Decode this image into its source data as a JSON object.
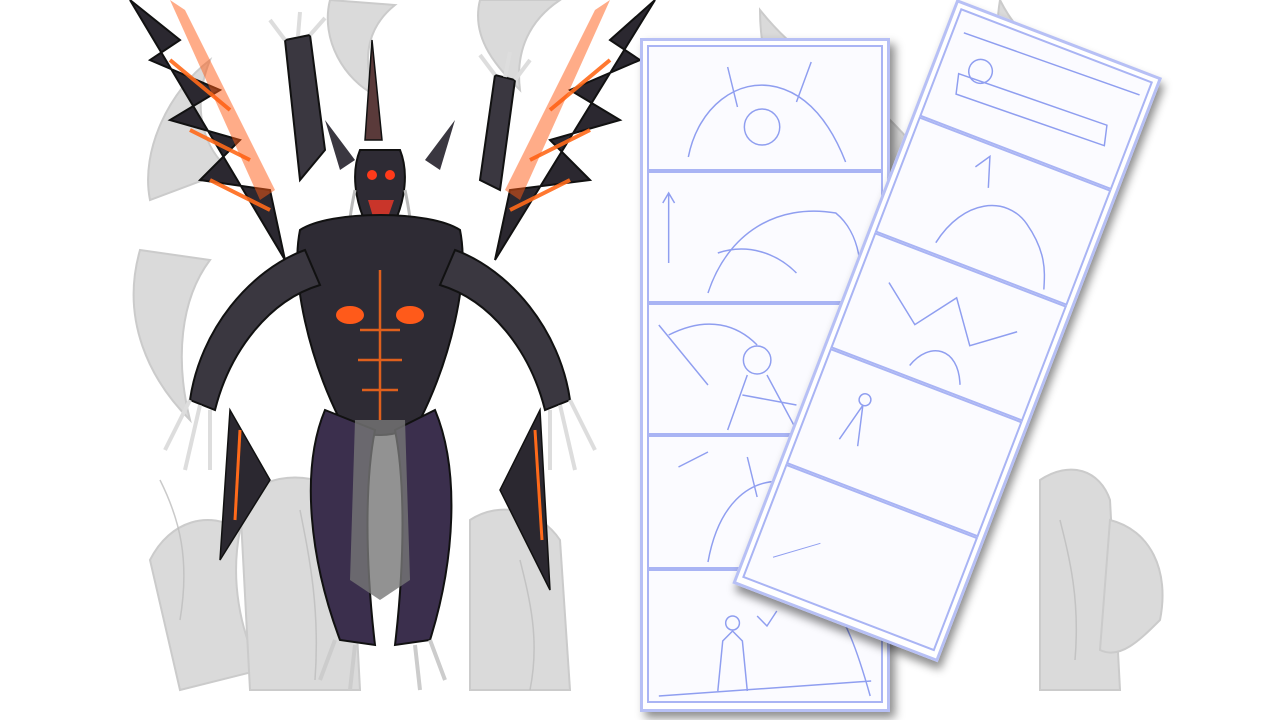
{
  "scene": {
    "accent_orange": "#ff6a1a",
    "demon_body": "#2e2b34",
    "demon_purple": "#3b2f4d",
    "sketch_blue": "#8f9ef0",
    "ghost_gray": "#cfcfcf"
  },
  "storyboard_front": {
    "panels": [
      "demon-face-closeup",
      "demon-lunge",
      "soldier-aiming",
      "demon-roar",
      "soldier-standing"
    ]
  },
  "storyboard_back": {
    "panels": [
      "soldier-gun",
      "demon-strike",
      "demon-wings",
      "distant-figure",
      "blank"
    ]
  }
}
